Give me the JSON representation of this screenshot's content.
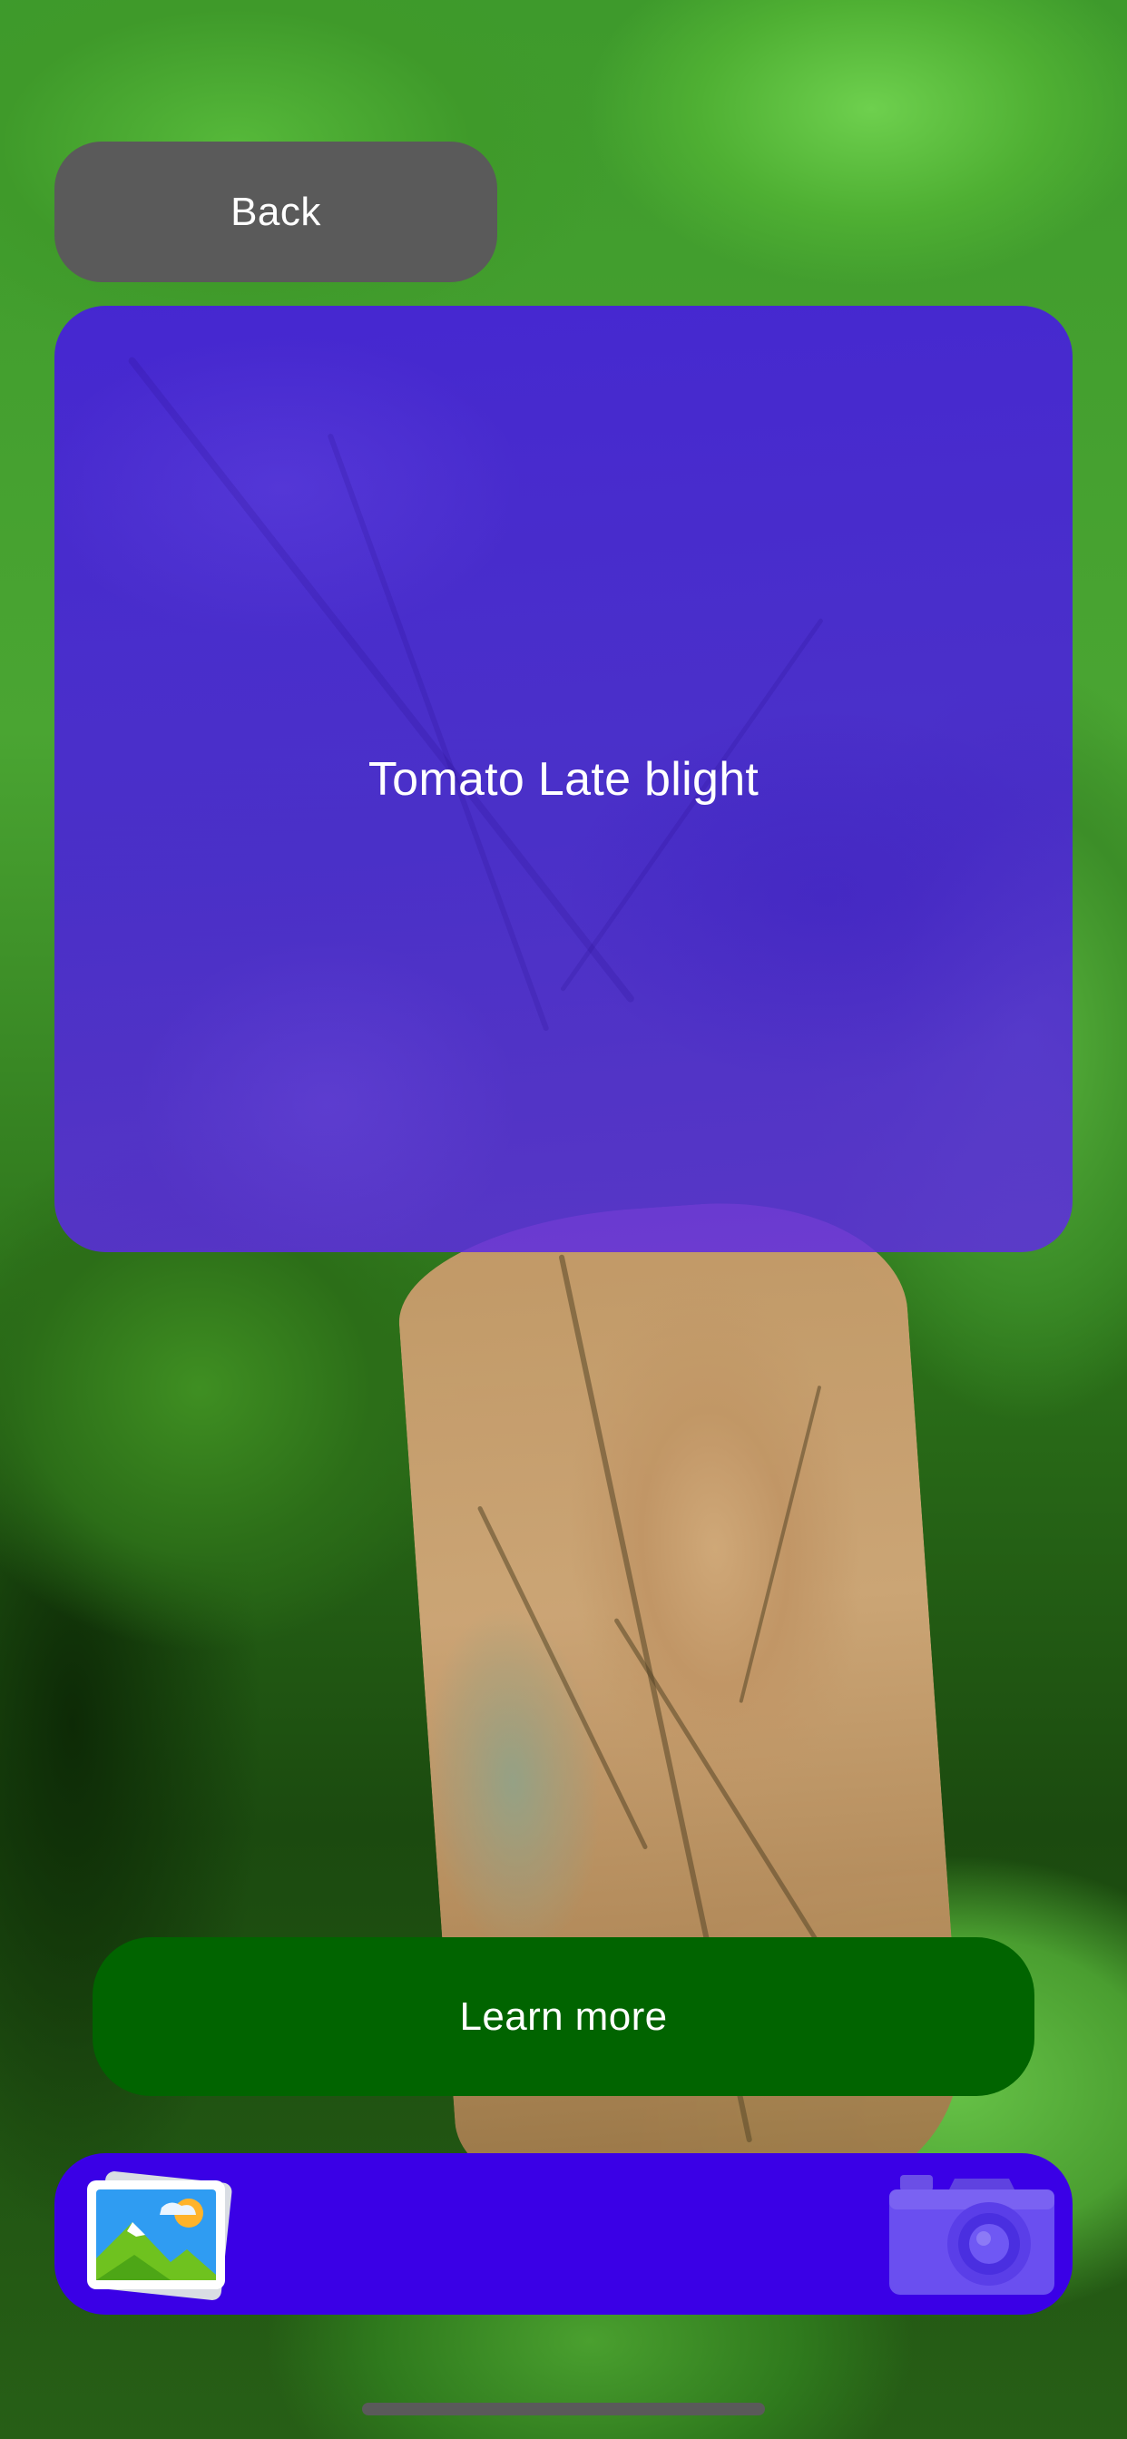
{
  "header": {
    "back_label": "Back"
  },
  "result": {
    "label": "Tomato Late blight"
  },
  "actions": {
    "learn_more_label": "Learn more"
  },
  "toolbar": {
    "gallery_icon": "photo-gallery-icon",
    "camera_icon": "camera-icon"
  },
  "colors": {
    "back_button": "#5a5a5a",
    "result_card": "#4a14eb",
    "learn_more_button": "#016400",
    "toolbar": "#3a00e6"
  }
}
